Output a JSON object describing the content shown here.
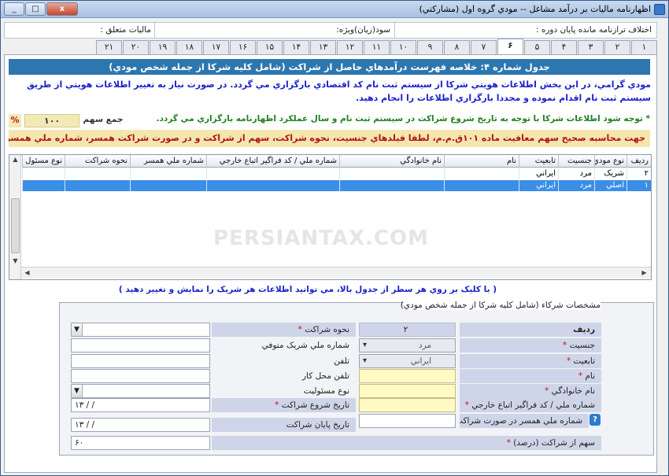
{
  "window": {
    "title": "اظهارنامه ماليات بر درآمد مشاغل -- مودي گروه اول (مشارکتي)",
    "buttons": [
      "_",
      "□",
      "x"
    ]
  },
  "topbar": {
    "diff_label": "اختلاف ترازنامه مانده پايان دوره :",
    "profit_label": "سود(زيان)ويژه:",
    "tax_label": "ماليات متعلق :"
  },
  "tabs": [
    "۱",
    "۲",
    "۳",
    "۴",
    "۵",
    "۶",
    "۷",
    "۸",
    "۹",
    "۱۰",
    "۱۱",
    "۱۲",
    "۱۳",
    "۱۴",
    "۱۵",
    "۱۶",
    "۱۷",
    "۱۸",
    "۱۹",
    "۲۰",
    "۲۱"
  ],
  "active_tab": "۶",
  "header": {
    "title": "جدول شماره ۴: خلاصه فهرست درآمدهاي حاصل از شراکت  (شامل کليه شرکا از جمله شخص مودي)"
  },
  "notices": {
    "line1": "مودي گرامي، در اين بخش اطلاعات هويتي شرکا از سيستم ثبت نام کد اقتصادي بارگزاري مي گردد. در صورت نياز به تغيير اطلاعات هويتي  از طريق سيستم ثبت نام اقدام نموده و مجددا بارگزاري اطلاعات را انجام دهيد.",
    "line2": "* توجه شود اطلاعات شرکا با توجه به تاريخ شروع شراکت در سيستم ثبت نام و سال عملکرد اظهارنامه بارگزاري مي گردد.",
    "share_sum_label": "جمع سهم",
    "share_sum_value": "۱۰۰",
    "percent_sign": "%",
    "line3": "جهت محاسبه صحيح سهم معافيت ماده ۱۰۱ق.م.م، لطفا فيلدهاي جنسيت، نحوه شراکت، سهم از شراکت و در صورت شراکت همسر، شماره ملي همسر را به صورت صحيح وارد نماييد."
  },
  "grid": {
    "columns": [
      "رديف",
      "نوع مودي",
      "جنسيت",
      "تابعيت",
      "نام",
      "نام خانوادگي",
      "شماره ملي / کد فراگير اتباع خارجي",
      "شماره ملي همسر",
      "نحوه شراکت",
      "نوع مسئول"
    ],
    "rows": [
      [
        "۲",
        "شريک",
        "مرد",
        "ايراني",
        "",
        "",
        "",
        "",
        "",
        ""
      ],
      [
        "۱",
        "اصلي",
        "مرد",
        "ايراني",
        "",
        "",
        "",
        "",
        "",
        ""
      ]
    ],
    "selected_row": 1,
    "watermark": "PERSIANTAX.COM"
  },
  "hint": "( با کليک بر روي هر سطر از جدول بالا، مي توانيد اطلاعات هر شريک را نمايش و تغيير دهيد )",
  "form": {
    "group_title": "مشخصات شرکاء  (شامل کليه شرکا از جمله شخص مودي)",
    "row_label": "رديف",
    "row_value": "۲",
    "gender_label": "جنسيت",
    "gender_value": "مرد",
    "nationality_label": "تابعيت",
    "nationality_value": "ايراني",
    "name_label": "نام",
    "name_value": "",
    "family_label": "نام خانوادگي",
    "family_value": "",
    "national_id_label": "شماره ملي / کد فراگير اتباع خارجي",
    "national_id_value": "",
    "spouse_id_label": "شماره ملي همسر در صورت شراکت",
    "share_percent_label": "سهم از شراکت (درصد)",
    "share_percent_value": "۶۰",
    "partnership_type_label": "نحوه شراکت",
    "partnership_type_value": "",
    "deceased_id_label": "شماره ملي شريک متوفي",
    "phone_label": "تلفن",
    "work_phone_label": "تلفن محل کار",
    "responsibility_label": "نوع مسئوليت",
    "start_date_label": "تاريخ شروع شراکت",
    "start_date_value": "۱۳  /  /",
    "end_date_label": "تاريخ پايان شراکت",
    "end_date_value": "۱۳  /  /",
    "required_mark": "*"
  }
}
